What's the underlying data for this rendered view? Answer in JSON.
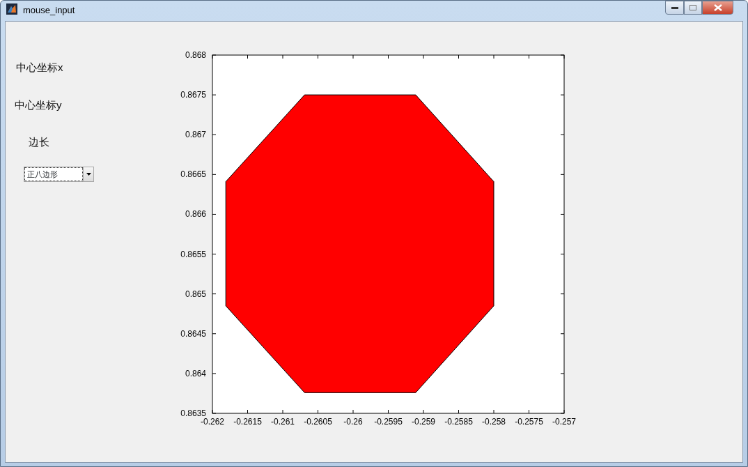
{
  "window": {
    "title": "mouse_input"
  },
  "panel": {
    "labels": [
      "中心坐标x",
      "中心坐标y",
      "边长"
    ],
    "dropdown": {
      "value": "正八边形"
    }
  },
  "axes": {
    "chart_data": {
      "type": "area",
      "xlim": [
        -0.262,
        -0.257
      ],
      "ylim": [
        0.8635,
        0.868
      ],
      "x": [
        -0.26069,
        -0.25911,
        -0.258,
        -0.258,
        -0.25911,
        -0.26069,
        -0.26181,
        -0.26181,
        -0.26069
      ],
      "series": [
        {
          "color": "#ff0000",
          "values": [
            0.8675,
            0.8675,
            0.86641,
            0.86485,
            0.86376,
            0.86376,
            0.86485,
            0.86641,
            0.8675
          ]
        }
      ],
      "xticks": [
        {
          "value": -0.262,
          "label": "-0.262"
        },
        {
          "value": -0.2615,
          "label": "-0.2615"
        },
        {
          "value": -0.261,
          "label": "-0.261"
        },
        {
          "value": -0.2605,
          "label": "-0.2605"
        },
        {
          "value": -0.26,
          "label": "-0.26"
        },
        {
          "value": -0.2595,
          "label": "-0.2595"
        },
        {
          "value": -0.259,
          "label": "-0.259"
        },
        {
          "value": -0.2585,
          "label": "-0.2585"
        },
        {
          "value": -0.258,
          "label": "-0.258"
        },
        {
          "value": -0.2575,
          "label": "-0.2575"
        },
        {
          "value": -0.257,
          "label": "-0.257"
        }
      ],
      "yticks": [
        {
          "value": 0.8635,
          "label": "0.8635"
        },
        {
          "value": 0.864,
          "label": "0.864"
        },
        {
          "value": 0.8645,
          "label": "0.8645"
        },
        {
          "value": 0.865,
          "label": "0.865"
        },
        {
          "value": 0.8655,
          "label": "0.8655"
        },
        {
          "value": 0.866,
          "label": "0.866"
        },
        {
          "value": 0.8665,
          "label": "0.8665"
        },
        {
          "value": 0.867,
          "label": "0.867"
        },
        {
          "value": 0.8675,
          "label": "0.8675"
        },
        {
          "value": 0.868,
          "label": "0.868"
        }
      ]
    }
  }
}
